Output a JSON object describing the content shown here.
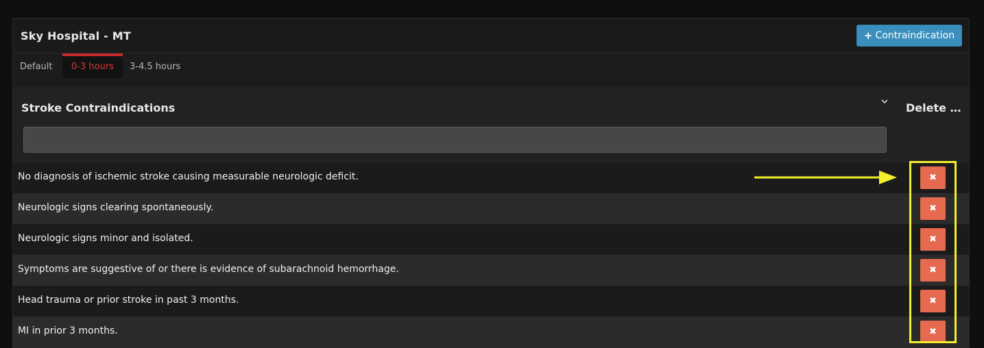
{
  "header": {
    "title": "Sky Hospital - MT",
    "add_button_icon": "plus-icon",
    "add_button_label": "Contraindication"
  },
  "tabs": [
    {
      "label": "Default",
      "active": false
    },
    {
      "label": "0-3 hours",
      "active": true
    },
    {
      "label": "3-4.5 hours",
      "active": false
    }
  ],
  "table": {
    "title_header": "Stroke Contraindications",
    "delete_header": "Delete …",
    "filter_value": "",
    "rows": [
      {
        "text": "No diagnosis of ischemic stroke causing measurable neurologic deficit.",
        "delete_icon": "close-icon"
      },
      {
        "text": "Neurologic signs clearing spontaneously.",
        "delete_icon": "close-icon"
      },
      {
        "text": "Neurologic signs minor and isolated.",
        "delete_icon": "close-icon"
      },
      {
        "text": "Symptoms are suggestive of or there is evidence of subarachnoid hemorrhage.",
        "delete_icon": "close-icon"
      },
      {
        "text": "Head trauma or prior stroke in past 3 months.",
        "delete_icon": "close-icon"
      },
      {
        "text": "MI in prior 3 months.",
        "delete_icon": "close-icon"
      }
    ]
  },
  "colors": {
    "accent_blue": "#3a8fbd",
    "active_tab_red": "#c62a2a",
    "delete_button": "#e56a4f",
    "annotation_yellow": "#f4ef2a"
  }
}
